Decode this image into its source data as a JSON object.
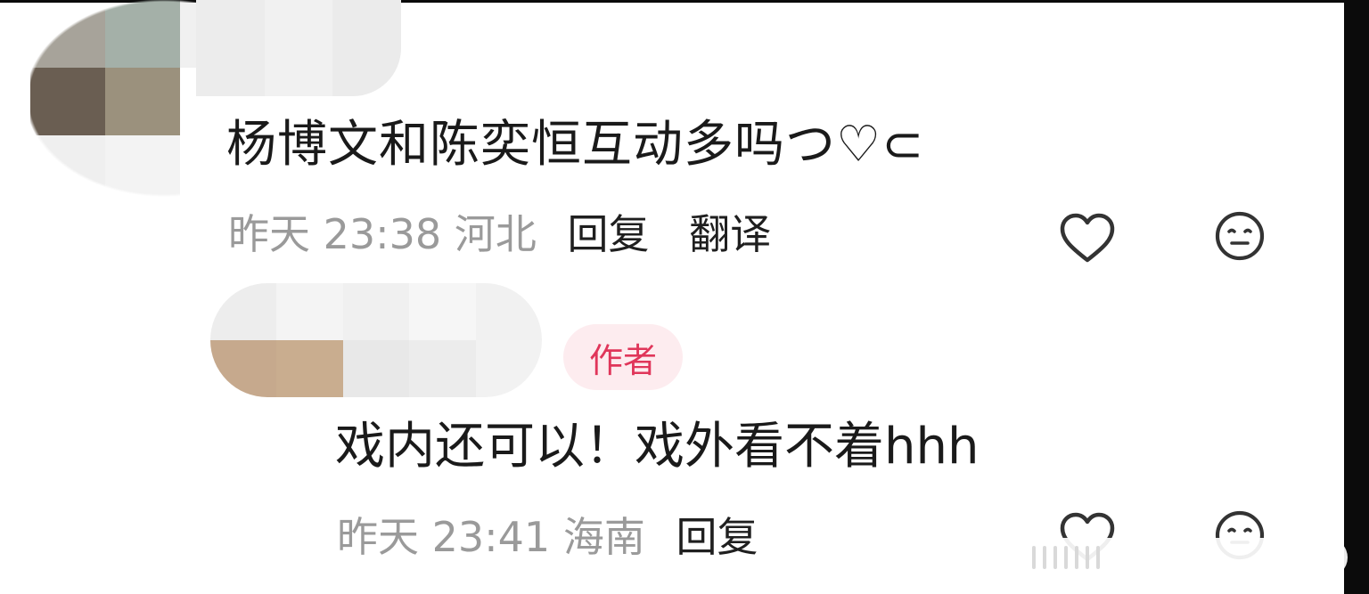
{
  "comments": [
    {
      "text": "杨博文和陈奕恒互动多吗つ♡⊂",
      "date": "昨天",
      "time": "23:38",
      "location": "河北",
      "actions": {
        "reply": "回复",
        "translate": "翻译"
      }
    },
    {
      "badge": "作者",
      "text": "戏内还可以！戏外看不着hhh",
      "date": "昨天",
      "time": "23:41",
      "location": "海南",
      "actions": {
        "reply": "回复"
      }
    }
  ],
  "icons": {
    "like": "heart-outline-icon",
    "dislike": "meh-face-icon"
  },
  "colors": {
    "badge_bg": "#fdecef",
    "badge_text": "#e0365a",
    "meta_text": "#9a9a9a",
    "body_text": "#1a1a1a"
  }
}
